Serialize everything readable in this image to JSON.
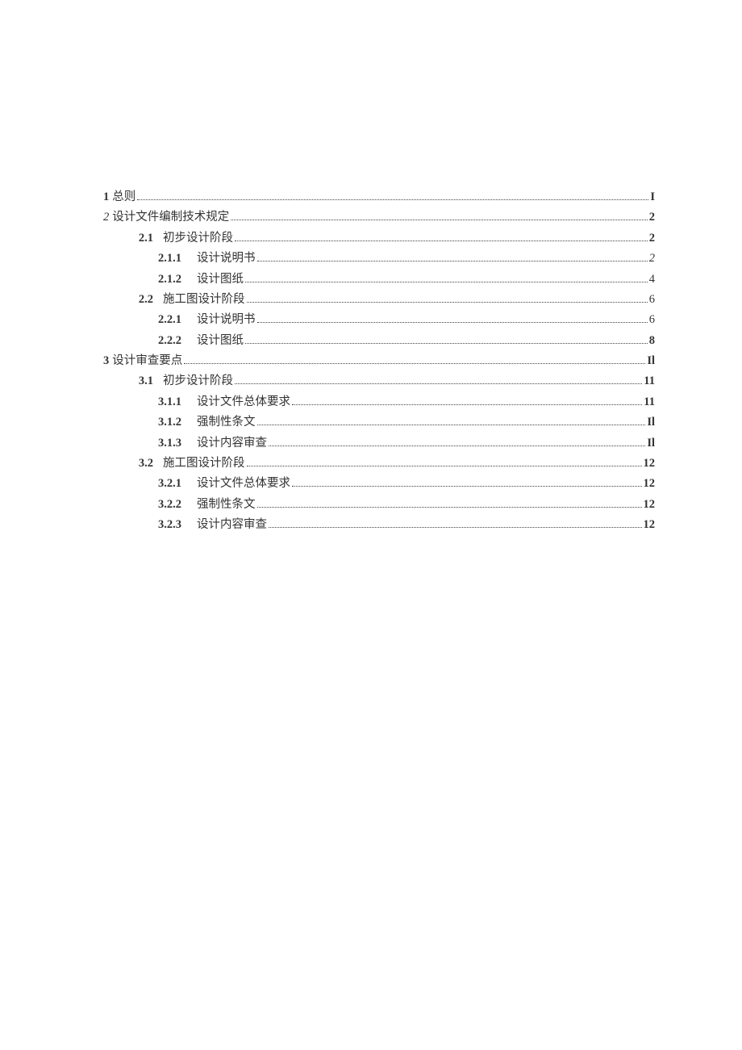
{
  "toc": [
    {
      "level": 0,
      "num": "1",
      "title": "总则",
      "page": "I",
      "numBold": true,
      "pageBold": true,
      "titleItalic": false,
      "pageItalic": false,
      "numItalic": false
    },
    {
      "level": 0,
      "num": "2",
      "title": "设计文件编制技术规定",
      "page": "2",
      "numBold": false,
      "pageBold": true,
      "titleItalic": false,
      "pageItalic": false,
      "numItalic": true
    },
    {
      "level": 1,
      "num": "2.1",
      "title": "初步设计阶段",
      "page": "2",
      "numBold": true,
      "pageBold": true,
      "titleItalic": false,
      "pageItalic": false,
      "numItalic": false
    },
    {
      "level": 2,
      "num": "2.1.1",
      "title": "设计说明书",
      "page": "2",
      "numBold": true,
      "pageBold": false,
      "titleItalic": false,
      "pageItalic": true,
      "numItalic": false
    },
    {
      "level": 2,
      "num": "2.1.2",
      "title": "设计图纸",
      "page": "4",
      "numBold": true,
      "pageBold": false,
      "titleItalic": false,
      "pageItalic": false,
      "numItalic": false
    },
    {
      "level": 1,
      "num": "2.2",
      "title": "施工图设计阶段",
      "page": "6",
      "numBold": true,
      "pageBold": false,
      "titleItalic": false,
      "pageItalic": false,
      "numItalic": false
    },
    {
      "level": 2,
      "num": "2.2.1",
      "title": "设计说明书",
      "page": "6",
      "numBold": true,
      "pageBold": false,
      "titleItalic": false,
      "pageItalic": false,
      "numItalic": false
    },
    {
      "level": 2,
      "num": "2.2.2",
      "title": "设计图纸",
      "page": "8",
      "numBold": true,
      "pageBold": true,
      "titleItalic": false,
      "pageItalic": false,
      "numItalic": false
    },
    {
      "level": 0,
      "num": "3",
      "title": "设计审查要点",
      "page": "Il",
      "numBold": true,
      "pageBold": true,
      "titleItalic": false,
      "pageItalic": false,
      "numItalic": false
    },
    {
      "level": 1,
      "num": "3.1",
      "title": "初步设计阶段",
      "page": "11",
      "numBold": true,
      "pageBold": true,
      "titleItalic": false,
      "pageItalic": false,
      "numItalic": false
    },
    {
      "level": 2,
      "num": "3.1.1",
      "title": "设计文件总体要求",
      "page": "11",
      "numBold": true,
      "pageBold": true,
      "titleItalic": false,
      "pageItalic": false,
      "numItalic": false
    },
    {
      "level": 2,
      "num": "3.1.2",
      "title": "强制性条文",
      "page": "Il",
      "numBold": true,
      "pageBold": true,
      "titleItalic": false,
      "pageItalic": false,
      "numItalic": false
    },
    {
      "level": 2,
      "num": "3.1.3",
      "title": "设计内容审查",
      "page": "Il",
      "numBold": true,
      "pageBold": true,
      "titleItalic": false,
      "pageItalic": false,
      "numItalic": false
    },
    {
      "level": 1,
      "num": "3.2",
      "title": "施工图设计阶段",
      "page": "12",
      "numBold": true,
      "pageBold": true,
      "titleItalic": false,
      "pageItalic": false,
      "numItalic": false
    },
    {
      "level": 2,
      "num": "3.2.1",
      "title": "设计文件总体要求",
      "page": "12",
      "numBold": true,
      "pageBold": true,
      "titleItalic": false,
      "pageItalic": false,
      "numItalic": false
    },
    {
      "level": 2,
      "num": "3.2.2",
      "title": "强制性条文",
      "page": "12",
      "numBold": true,
      "pageBold": true,
      "titleItalic": false,
      "pageItalic": false,
      "numItalic": false
    },
    {
      "level": 2,
      "num": "3.2.3",
      "title": "设计内容审查",
      "page": "12",
      "numBold": true,
      "pageBold": true,
      "titleItalic": false,
      "pageItalic": false,
      "numItalic": false
    }
  ]
}
